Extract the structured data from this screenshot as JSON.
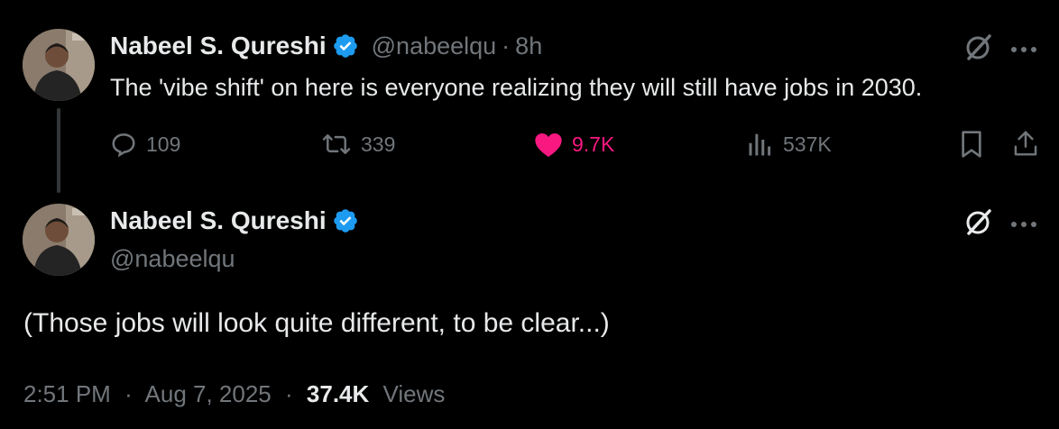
{
  "colors": {
    "background": "#000000",
    "text_primary": "#e7e9ea",
    "text_secondary": "#71767b",
    "verified_blue": "#1d9bf0",
    "like_pink": "#f91880",
    "thread_line": "#333639"
  },
  "reply_tweet": {
    "author": {
      "display_name": "Nabeel S. Qureshi",
      "handle": "@nabeelqu",
      "verified": true,
      "avatar_icon": "avatar-photo"
    },
    "separator": "·",
    "time": "8h",
    "text": "The 'vibe shift' on here is everyone realizing they will still have jobs in 2030.",
    "actions": {
      "replies": "109",
      "reposts": "339",
      "likes": "9.7K",
      "views": "537K",
      "liked": true
    },
    "icons": [
      "grok-icon",
      "more-icon",
      "reply-icon",
      "repost-icon",
      "heart-icon",
      "views-icon",
      "bookmark-icon",
      "share-icon"
    ]
  },
  "main_tweet": {
    "author": {
      "display_name": "Nabeel S. Qureshi",
      "handle": "@nabeelqu",
      "verified": true,
      "avatar_icon": "avatar-photo"
    },
    "text": "(Those jobs will look quite different, to be clear...)",
    "meta": {
      "time": "2:51 PM",
      "separator": "·",
      "date": "Aug 7, 2025",
      "views_count": "37.4K",
      "views_label": "Views"
    },
    "icons": [
      "grok-icon",
      "more-icon"
    ]
  }
}
